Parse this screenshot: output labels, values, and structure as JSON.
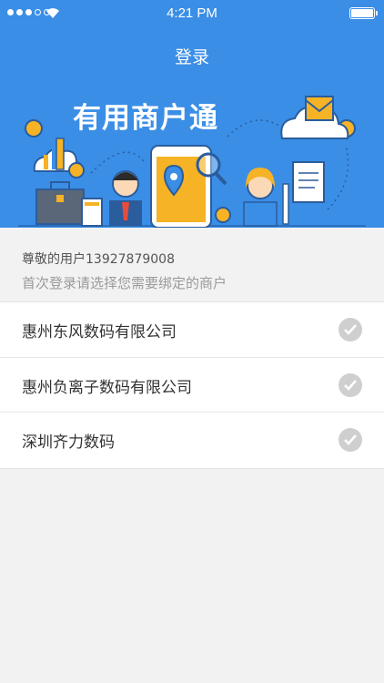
{
  "status_bar": {
    "time": "4:21 PM",
    "signal_icon": "signal-dots-icon",
    "wifi_icon": "wifi-icon",
    "battery_icon": "battery-icon"
  },
  "header": {
    "title": "登录"
  },
  "banner": {
    "headline": "有用商户通"
  },
  "info": {
    "greeting": "尊敬的用户13927879008",
    "hint": "首次登录请选择您需要绑定的商户"
  },
  "merchants": [
    {
      "name": "惠州东风数码有限公司",
      "check_icon": "checkmark-circle-icon"
    },
    {
      "name": "惠州负离子数码有限公司",
      "check_icon": "checkmark-circle-icon"
    },
    {
      "name": "深圳齐力数码",
      "check_icon": "checkmark-circle-icon"
    }
  ],
  "colors": {
    "primary": "#3a8ee6",
    "check_inactive": "#cfcfcf",
    "background": "#f2f2f2"
  }
}
